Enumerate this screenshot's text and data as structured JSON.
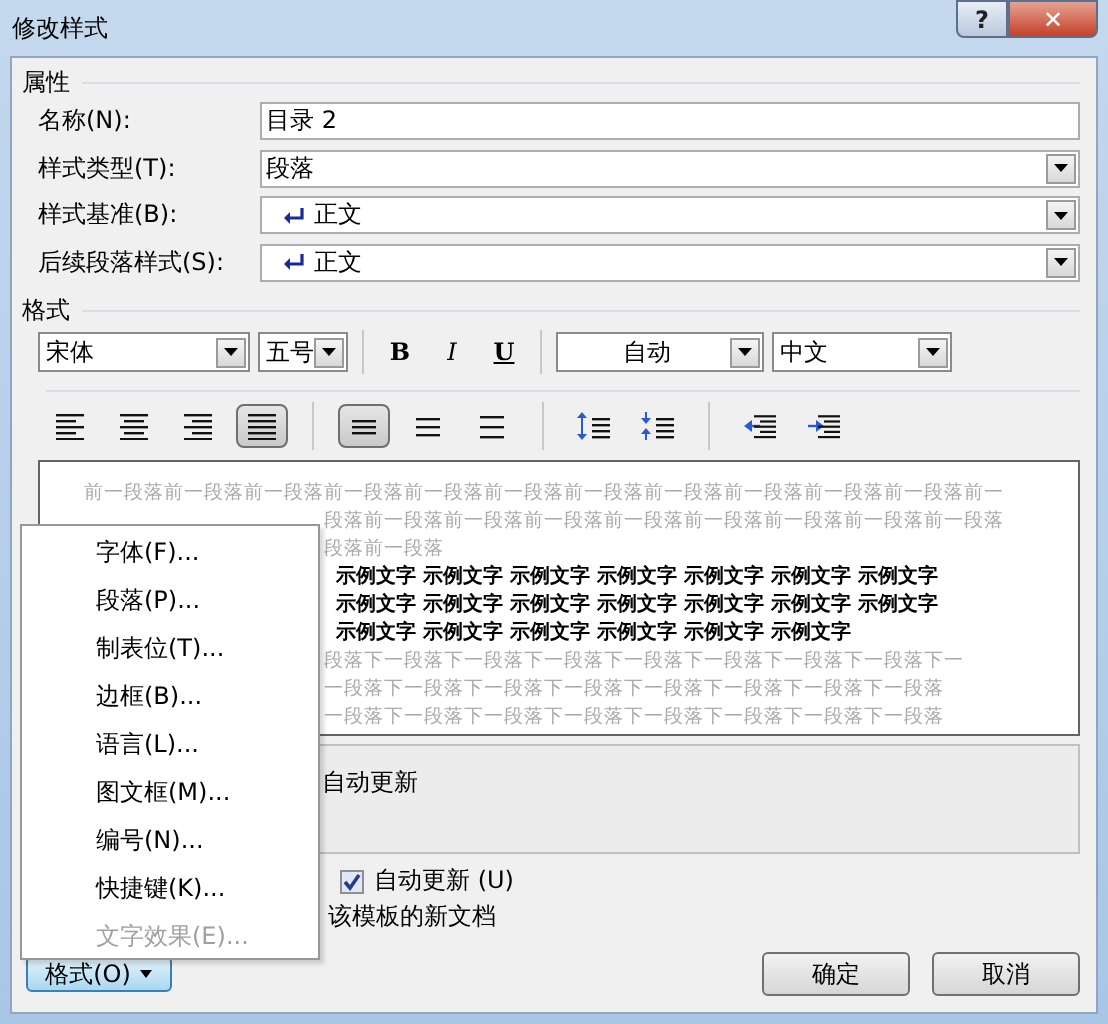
{
  "window": {
    "title": "修改样式",
    "help": "?",
    "close": "✕"
  },
  "properties": {
    "heading": "属性",
    "rows": [
      {
        "label": "名称(N):",
        "value": "目录 2",
        "kind": "text",
        "para_mark": false
      },
      {
        "label": "样式类型(T):",
        "value": "段落",
        "kind": "combo",
        "para_mark": false
      },
      {
        "label": "样式基准(B):",
        "value": "正文",
        "kind": "combo",
        "para_mark": true
      },
      {
        "label": "后续段落样式(S):",
        "value": "正文",
        "kind": "combo",
        "para_mark": true
      }
    ]
  },
  "format": {
    "heading": "格式",
    "font": "宋体",
    "size": "五号",
    "bold": "B",
    "italic": "I",
    "underline": "U",
    "font_color": "自动",
    "language": "中文",
    "align_buttons": [
      {
        "kind": "left",
        "selected": false
      },
      {
        "kind": "center",
        "selected": false
      },
      {
        "kind": "right",
        "selected": false
      },
      {
        "kind": "justify",
        "selected": true
      }
    ],
    "spacing_buttons": [
      {
        "kind": "single",
        "selected": true
      },
      {
        "kind": "onehalf",
        "selected": false
      },
      {
        "kind": "double",
        "selected": false
      }
    ]
  },
  "preview": {
    "first_line": "前一段落前一段落前一段落前一段落前一段落前一段落前一段落前一段落前一段落前一段落前一段落前一",
    "lines_beside_menu": [
      {
        "kind": "before",
        "text": "段落前一段落前一段落前一段落前一段落前一段落前一段落前一段落前一段落"
      },
      {
        "kind": "before",
        "text": "段落前一段落"
      },
      {
        "kind": "sample",
        "text": "示例文字 示例文字 示例文字 示例文字 示例文字 示例文字 示例文字"
      },
      {
        "kind": "sample",
        "text": "示例文字 示例文字 示例文字 示例文字 示例文字 示例文字 示例文字"
      },
      {
        "kind": "sample",
        "text": "示例文字 示例文字 示例文字 示例文字 示例文字 示例文字"
      },
      {
        "kind": "after",
        "text": "段落下一段落下一段落下一段落下一段落下一段落下一段落下一段落下一"
      },
      {
        "kind": "after",
        "text": "一段落下一段落下一段落下一段落下一段落下一段落下一段落下一段落"
      },
      {
        "kind": "after",
        "text": "一段落下一段落下一段落下一段落下一段落下一段落下一段落下一段落"
      }
    ]
  },
  "description": "自动更新",
  "auto_update": {
    "label": "自动更新 (U)",
    "checked": true
  },
  "template_text": "该模板的新文档",
  "format_menu": {
    "items": [
      {
        "label": "字体(F)...",
        "disabled": false
      },
      {
        "label": "段落(P)...",
        "disabled": false
      },
      {
        "label": "制表位(T)...",
        "disabled": false
      },
      {
        "label": "边框(B)...",
        "disabled": false
      },
      {
        "label": "语言(L)...",
        "disabled": false
      },
      {
        "label": "图文框(M)...",
        "disabled": false
      },
      {
        "label": "编号(N)...",
        "disabled": false
      },
      {
        "label": "快捷键(K)...",
        "disabled": false
      },
      {
        "label": "文字效果(E)...",
        "disabled": true
      }
    ]
  },
  "buttons": {
    "format": "格式(O)",
    "ok": "确定",
    "cancel": "取消"
  }
}
